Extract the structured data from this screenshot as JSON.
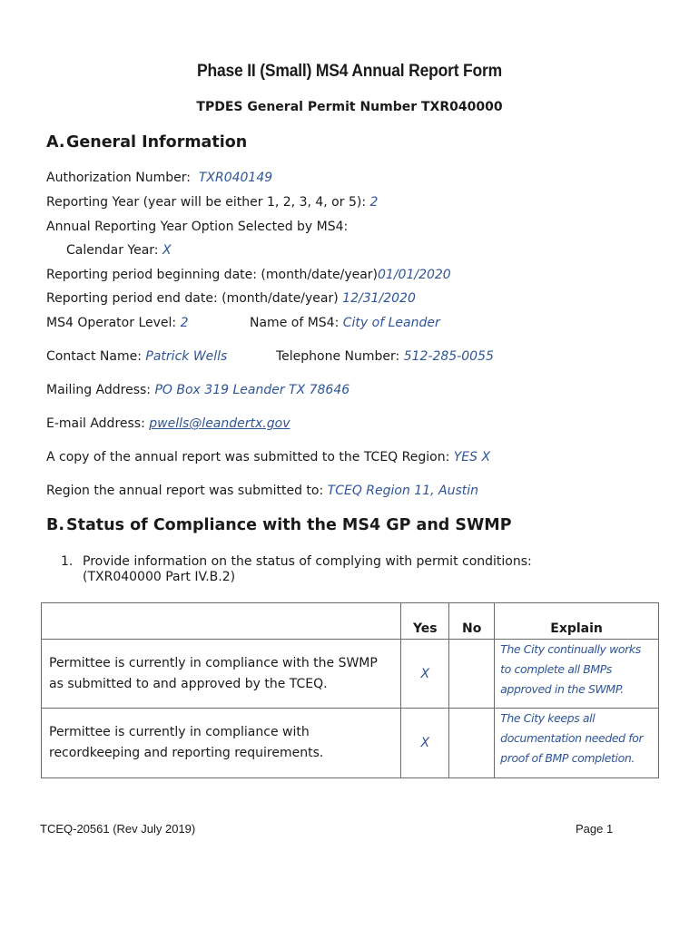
{
  "header": {
    "title": "Phase II (Small) MS4 Annual Report Form",
    "subtitle": "TPDES General Permit Number TXR040000"
  },
  "section_a": {
    "letter": "A.",
    "heading": "General Information",
    "authorization_number": {
      "label": "Authorization Number:",
      "value": "TXR040149"
    },
    "reporting_year": {
      "label": "Reporting Year (year will be either 1, 2, 3, 4, or 5):",
      "value": "2"
    },
    "year_option": {
      "label": "Annual Reporting Year Option Selected by MS4:"
    },
    "calendar_year": {
      "label": "Calendar Year:",
      "value": "X"
    },
    "period_begin": {
      "label": "Reporting period beginning date: (month/date/year)",
      "value": "01/01/2020"
    },
    "period_end": {
      "label": "Reporting period end date: (month/date/year)",
      "value": "12/31/2020"
    },
    "operator_level": {
      "label": "MS4 Operator Level:",
      "value": "2"
    },
    "ms4_name": {
      "label": "Name of MS4:",
      "value": "City of Leander"
    },
    "contact_name": {
      "label": "Contact Name:",
      "value": "Patrick Wells"
    },
    "telephone": {
      "label": "Telephone Number:",
      "value": "512-285-0055"
    },
    "mailing_address": {
      "label": "Mailing Address:",
      "value": "PO Box 319 Leander TX 78646"
    },
    "email": {
      "label": "E-mail Address:",
      "value": "pwells@leandertx.gov"
    },
    "copy_submitted": {
      "label": "A copy of the annual report was submitted to the TCEQ Region:",
      "value": "YES X"
    },
    "region_submitted": {
      "label": "Region the annual report was submitted to:",
      "value": "TCEQ Region 11, Austin"
    }
  },
  "section_b": {
    "letter": "B.",
    "heading": "Status of Compliance with the MS4 GP and SWMP",
    "item_1": {
      "number": "1.",
      "text": "Provide information on the status of complying with permit conditions:",
      "text_cont": "(TXR040000 Part IV.B.2)"
    },
    "table": {
      "headers": [
        "",
        "Yes",
        "No",
        "Explain"
      ],
      "rows": [
        {
          "description": "Permittee is currently in compliance with the SWMP as submitted to and approved by the TCEQ.",
          "yes": "X",
          "no": "",
          "explain": "The City continually works to complete all BMPs approved in the SWMP."
        },
        {
          "description": "Permittee is currently in compliance with recordkeeping and reporting requirements.",
          "yes": "X",
          "no": "",
          "explain": "The City keeps all documentation needed for proof of BMP completion."
        }
      ]
    }
  },
  "footer": {
    "form_id": "TCEQ-20561 (Rev July 2019)",
    "page": "Page 1"
  },
  "colors": {
    "value_text": "#2f5597",
    "body_text": "#1a1a1a",
    "table_border": "#6b6b6b"
  }
}
